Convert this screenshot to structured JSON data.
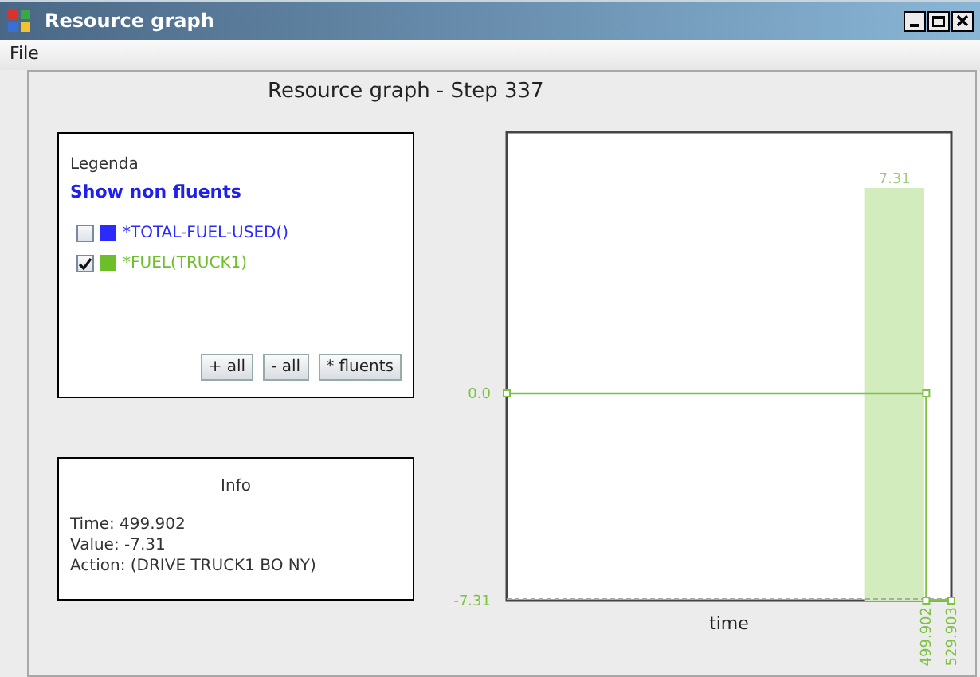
{
  "window": {
    "title": "Resource graph"
  },
  "menu": [
    "File"
  ],
  "heading": "Resource graph - Step 337",
  "legend": {
    "title": "Legenda",
    "toggle_link": "Show non fluents",
    "items": [
      {
        "label": "*TOTAL-FUEL-USED()",
        "checked": false,
        "color": "#2b2bff"
      },
      {
        "label": "*FUEL(TRUCK1)",
        "checked": true,
        "color": "#6cbf2a"
      }
    ],
    "buttons": [
      "+ all",
      "- all",
      "* fluents"
    ]
  },
  "info": {
    "title": "Info",
    "lines": [
      "Time: 499.902",
      "Value: -7.31",
      "Action: (DRIVE TRUCK1 BO NY)"
    ]
  },
  "chart": {
    "chart_data": {
      "type": "line",
      "xlabel": "time",
      "x": [
        0,
        499.902,
        499.902,
        529.903
      ],
      "series": [
        {
          "color": "#7dc242",
          "marker": "square",
          "values": [
            0,
            0,
            -7.31,
            -7.31
          ]
        }
      ],
      "xlim": [
        0,
        529.903
      ],
      "ylim": [
        -7.31,
        9.22
      ],
      "xticks": [
        {
          "value": 499.902,
          "label": "499.902"
        },
        {
          "value": 529.903,
          "label": "529.903"
        }
      ],
      "yticks": [
        {
          "value": 0,
          "label": "0.0"
        },
        {
          "value": -7.31,
          "label": "-7.31"
        }
      ],
      "bands": [
        {
          "axis": "x",
          "from": 427,
          "to": 497.5,
          "label": "7.31",
          "color": "#d2ecbe"
        }
      ]
    }
  }
}
